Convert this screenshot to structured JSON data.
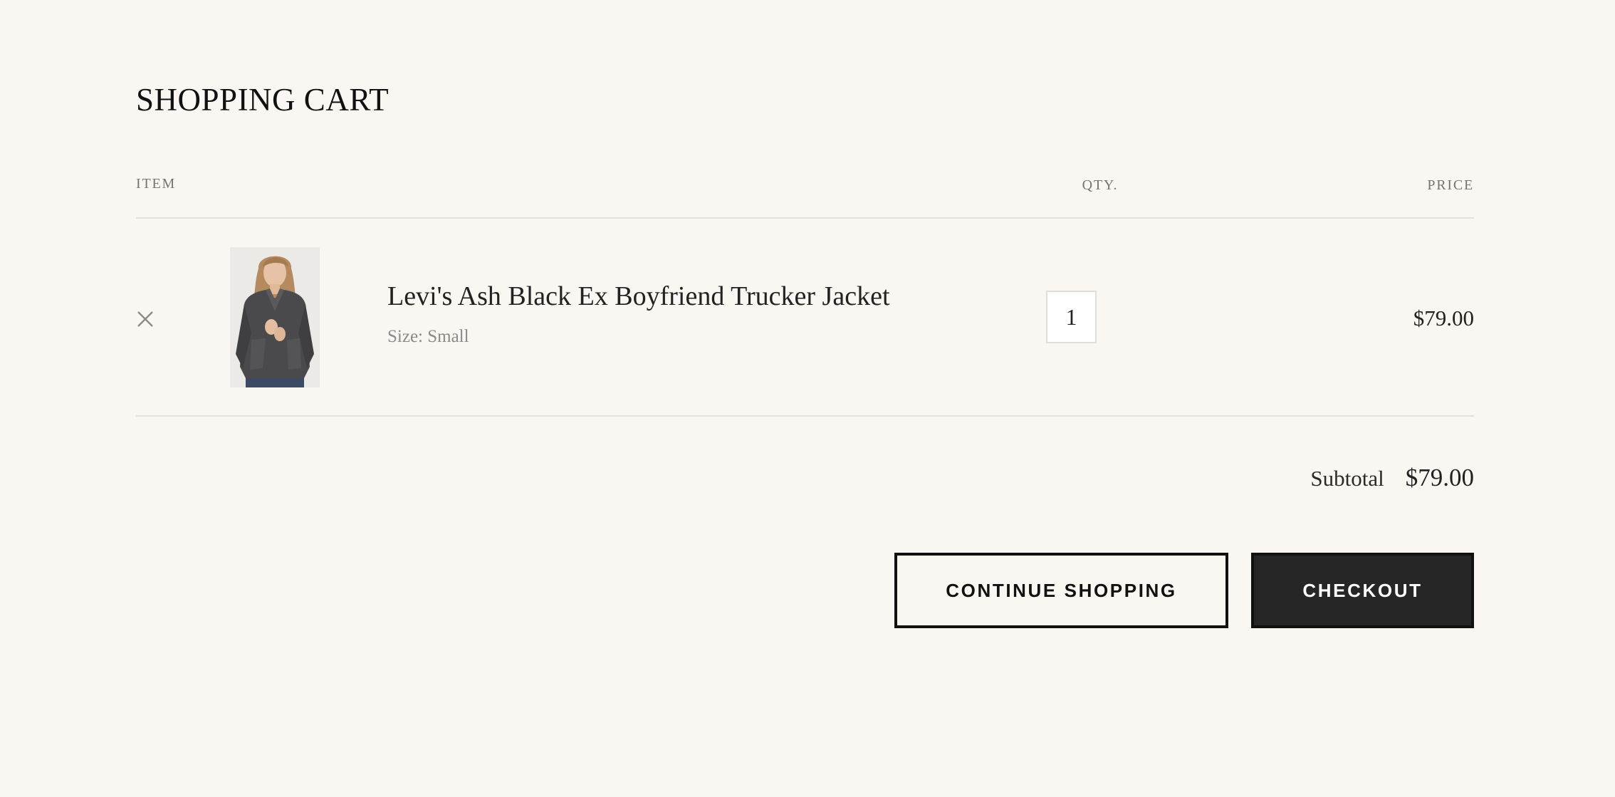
{
  "cart": {
    "title": "SHOPPING CART",
    "columns": {
      "item": "ITEM",
      "qty": "QTY.",
      "price": "PRICE"
    },
    "items": [
      {
        "name": "Levi's Ash Black Ex Boyfriend Trucker Jacket",
        "variant": "Size: Small",
        "quantity": "1",
        "price": "$79.00",
        "image_icon": "product-photo-denim-jacket"
      }
    ],
    "subtotal": {
      "label": "Subtotal",
      "value": "$79.00"
    },
    "actions": {
      "continue_label": "CONTINUE SHOPPING",
      "checkout_label": "CHECKOUT"
    }
  },
  "colors": {
    "background": "#faf7f3",
    "text": "#1f1f1f",
    "muted": "#8a8a8a",
    "divider": "#e3e1dd",
    "checkout_bg": "#262626"
  },
  "icons": {
    "remove": "close-icon"
  }
}
